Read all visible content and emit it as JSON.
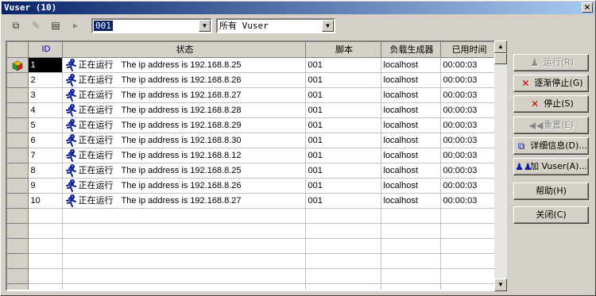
{
  "window": {
    "title": "Vuser (10)",
    "close_glyph": "×"
  },
  "toolbar": {
    "buttons": [
      {
        "name": "details-icon",
        "glyph": "⧉",
        "enabled": true
      },
      {
        "name": "edit-icon",
        "glyph": "✎",
        "enabled": false
      },
      {
        "name": "log-icon",
        "glyph": "▤",
        "enabled": true
      },
      {
        "name": "run-one-icon",
        "glyph": "▸",
        "enabled": false
      }
    ],
    "id_filter": {
      "value": "001"
    },
    "vuser_filter": {
      "value": "所有 Vuser"
    }
  },
  "grid": {
    "columns": [
      "ID",
      "状态",
      "脚本",
      "负载生成器",
      "已用时间"
    ],
    "rows": [
      {
        "id": "1",
        "status": "正在运行",
        "message": "The ip address is 192.168.8.25",
        "script": "001",
        "generator": "localhost",
        "elapsed": "00:00:03"
      },
      {
        "id": "2",
        "status": "正在运行",
        "message": "The ip address is 192.168.8.26",
        "script": "001",
        "generator": "localhost",
        "elapsed": "00:00:03"
      },
      {
        "id": "3",
        "status": "正在运行",
        "message": "The ip address is 192.168.8.27",
        "script": "001",
        "generator": "localhost",
        "elapsed": "00:00:03"
      },
      {
        "id": "4",
        "status": "正在运行",
        "message": "The ip address is 192.168.8.28",
        "script": "001",
        "generator": "localhost",
        "elapsed": "00:00:03"
      },
      {
        "id": "5",
        "status": "正在运行",
        "message": "The ip address is 192.168.8.29",
        "script": "001",
        "generator": "localhost",
        "elapsed": "00:00:03"
      },
      {
        "id": "6",
        "status": "正在运行",
        "message": "The ip address is 192.168.8.30",
        "script": "001",
        "generator": "localhost",
        "elapsed": "00:00:03"
      },
      {
        "id": "7",
        "status": "正在运行",
        "message": "The ip address is 192.168.8.12",
        "script": "001",
        "generator": "localhost",
        "elapsed": "00:00:03"
      },
      {
        "id": "8",
        "status": "正在运行",
        "message": "The ip address is 192.168.8.25",
        "script": "001",
        "generator": "localhost",
        "elapsed": "00:00:03"
      },
      {
        "id": "9",
        "status": "正在运行",
        "message": "The ip address is 192.168.8.26",
        "script": "001",
        "generator": "localhost",
        "elapsed": "00:00:03"
      },
      {
        "id": "10",
        "status": "正在运行",
        "message": "The ip address is 192.168.8.27",
        "script": "001",
        "generator": "localhost",
        "elapsed": "00:00:03"
      }
    ],
    "empty_rows": 6,
    "selected_row_index": 0
  },
  "buttons": [
    {
      "name": "run-button",
      "label": "运行(R)",
      "icon": "run-icon",
      "glyph": "♟",
      "enabled": false
    },
    {
      "name": "gradual-stop-button",
      "label": "逐渐停止(G)",
      "icon": "gradual-stop-icon",
      "glyph": "✕",
      "enabled": true
    },
    {
      "name": "stop-button",
      "label": "停止(S)",
      "icon": "stop-icon",
      "glyph": "✕",
      "enabled": true
    },
    {
      "name": "reset-button",
      "label": "重置(E)",
      "icon": "reset-icon",
      "glyph": "◀◀",
      "enabled": false
    },
    {
      "name": "details-button",
      "label": "详细信息(D)...",
      "icon": "details-icon",
      "glyph": "⧉",
      "enabled": true
    },
    {
      "name": "add-vuser-button",
      "label": "加 Vuser(A)...",
      "icon": "users-icon",
      "glyph": "♟♟",
      "enabled": true
    },
    {
      "name": "help-button",
      "label": "帮助(H)",
      "icon": "",
      "glyph": "",
      "enabled": true
    },
    {
      "name": "close-button",
      "label": "关闭(C)",
      "icon": "",
      "glyph": "",
      "enabled": true
    }
  ],
  "colors": {
    "running_icon": "#0a1e9a",
    "stop_icon": "#cc0000",
    "header_id": "#0000c0"
  }
}
